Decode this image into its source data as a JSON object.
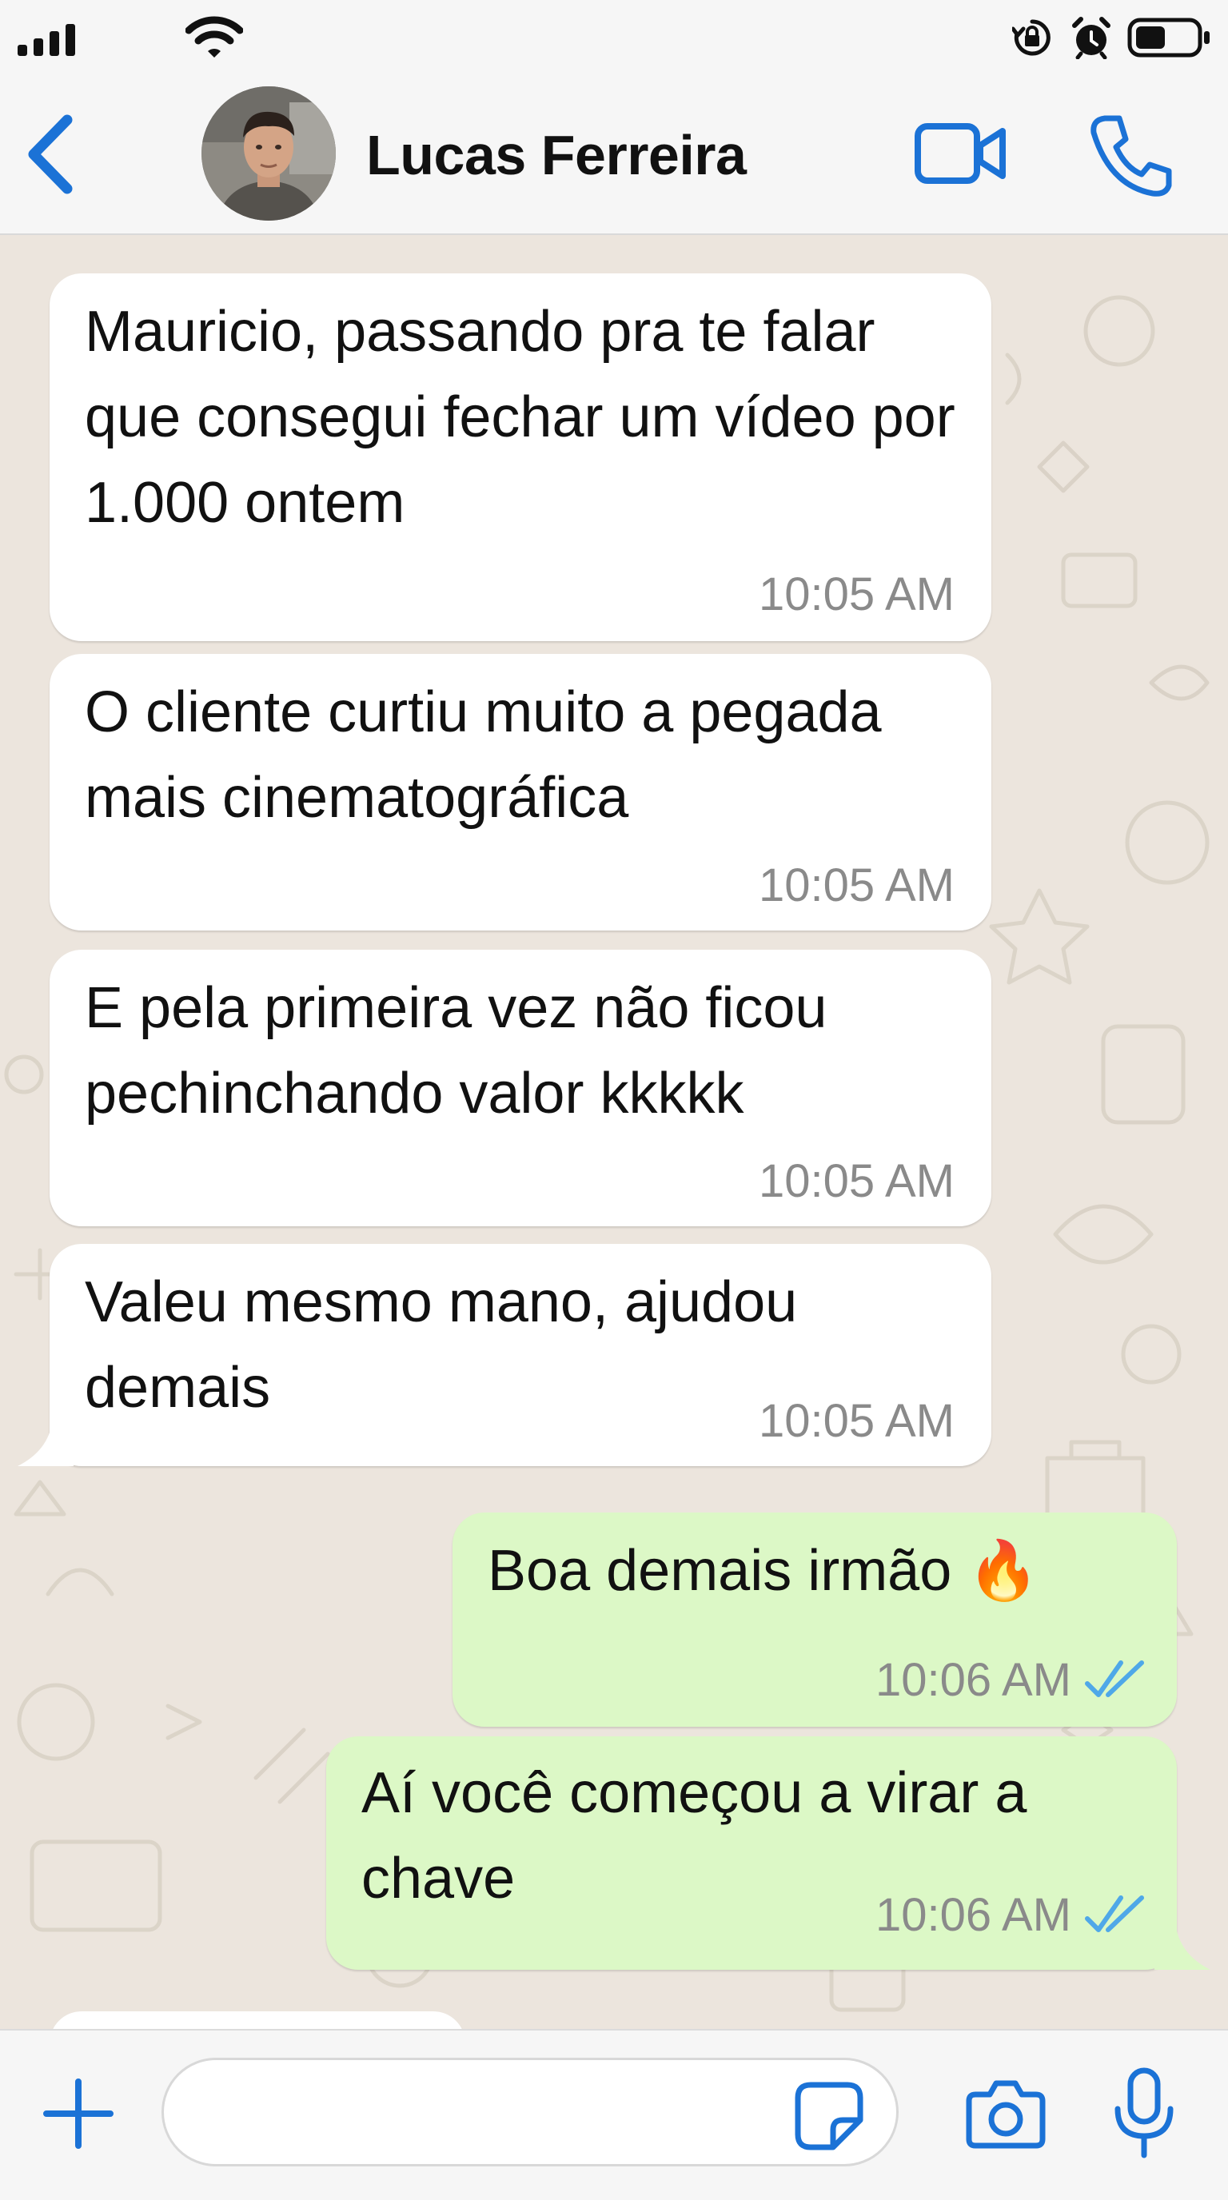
{
  "status_bar": {
    "icons": [
      "cellular-signal-icon",
      "wifi-icon",
      "orientation-lock-icon",
      "alarm-icon",
      "battery-icon"
    ]
  },
  "header": {
    "contact_name": "Lucas Ferreira",
    "icons": [
      "chevron-left-icon",
      "video-camera-icon",
      "phone-icon"
    ],
    "accent_color": "#1b72d6"
  },
  "messages": [
    {
      "direction": "incoming",
      "text": "Mauricio, passando pra te falar que consegui fechar um vídeo por 1.000 ontem",
      "time": "10:05 AM"
    },
    {
      "direction": "incoming",
      "text": "O cliente curtiu muito a pegada mais cinematográfica",
      "time": "10:05 AM"
    },
    {
      "direction": "incoming",
      "text": "E pela primeira vez não ficou pechinchando valor kkkkk",
      "time": "10:05 AM"
    },
    {
      "direction": "incoming",
      "text": "Valeu mesmo mano, ajudou demais",
      "time": "10:05 AM"
    },
    {
      "direction": "outgoing",
      "text": "Boa demais irmão 🔥",
      "time": "10:06 AM",
      "status": "read"
    },
    {
      "direction": "outgoing",
      "text": "Aí você começou a virar a chave",
      "time": "10:06 AM",
      "status": "read"
    }
  ],
  "input_bar": {
    "placeholder": "",
    "icons": [
      "plus-icon",
      "sticker-icon",
      "camera-icon",
      "microphone-icon"
    ]
  },
  "colors": {
    "incoming_bubble": "#ffffff",
    "outgoing_bubble": "#dcf8c6",
    "chat_background": "#ece5dd",
    "read_ticks": "#4fa8e8"
  }
}
